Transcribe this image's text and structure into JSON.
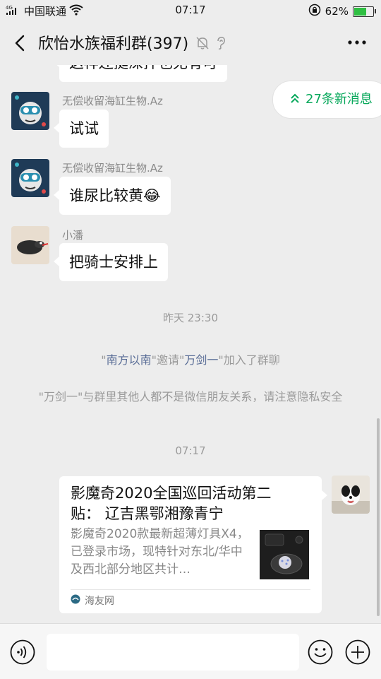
{
  "status_bar": {
    "network_type": "4G",
    "carrier": "中国联通",
    "time": "07:17",
    "battery_percent_label": "62%",
    "battery_level": 0.62
  },
  "header": {
    "title": "欣怡水族福利群(397)"
  },
  "new_messages_pill": {
    "label": "27条新消息"
  },
  "messages": [
    {
      "sender": "",
      "text": "这样还挺深拌也无有可"
    },
    {
      "sender": "无偿收留海缸生物.Az",
      "text": "试试"
    },
    {
      "sender": "无偿收留海缸生物.Az",
      "text": "谁尿比较黄😂"
    },
    {
      "sender": "小潘",
      "text": "把骑士安排上"
    }
  ],
  "time_divider_1": "昨天 23:30",
  "system_invite": {
    "q1": "\"",
    "inviter": "南方以南",
    "mid": "\"邀请\"",
    "invitee": "万剑一",
    "end": "\"加入了群聊"
  },
  "system_warning": "\"万剑一\"与群里其他人都不是微信朋友关系，请注意隐私安全",
  "time_divider_2": "07:17",
  "link_card": {
    "title": "影魔奇2020全国巡回活动第二贴：  辽吉黑鄂湘豫青宁",
    "description": "影魔奇2020款最新超薄灯具X4，已登录市场，现特针对东北/华中及西北部分地区共计…",
    "source": "海友网"
  },
  "colors": {
    "background": "#ededed",
    "accent_green": "#07a85b",
    "link_blue": "#576b95",
    "battery_green": "#2fbf42"
  }
}
